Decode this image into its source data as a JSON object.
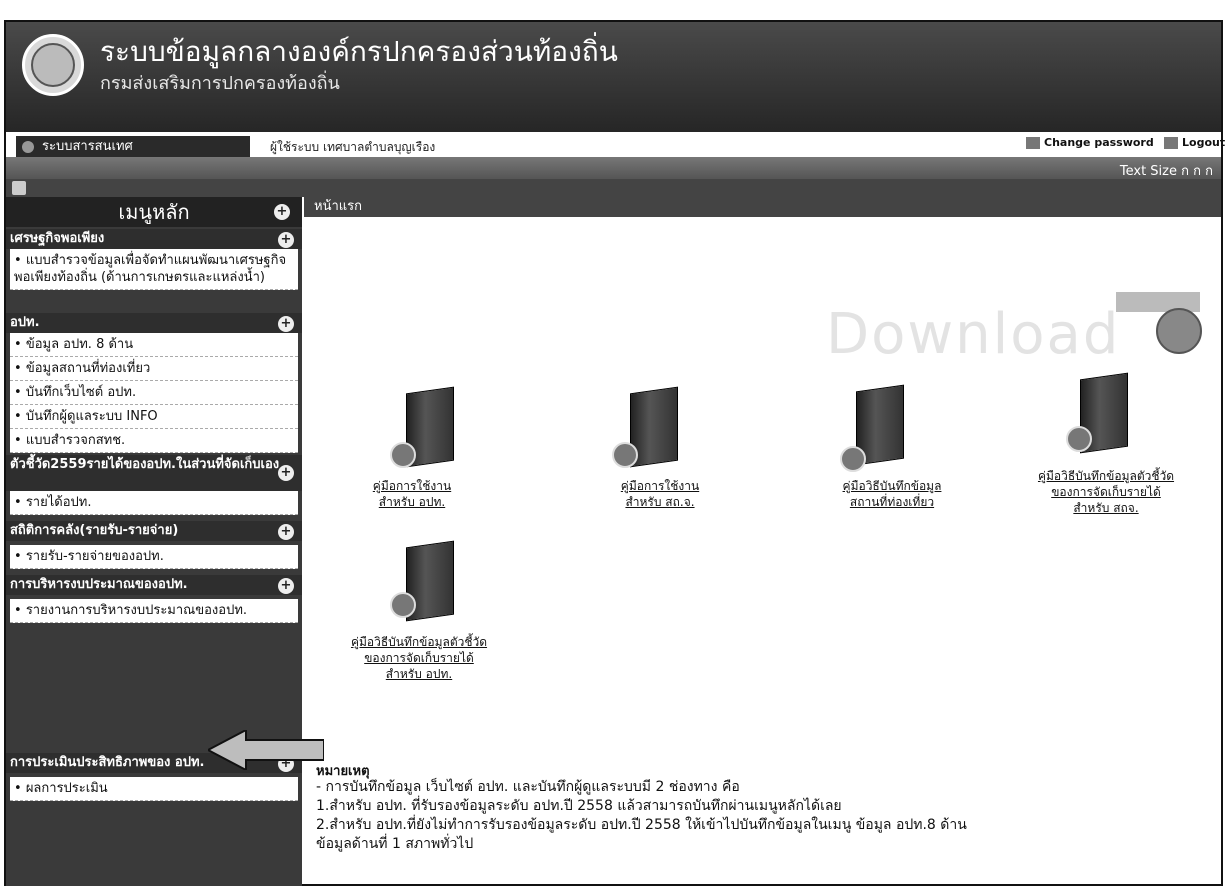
{
  "header": {
    "title": "ระบบข้อมูลกลางองค์กรปกครองส่วนท้องถิ่น",
    "subtitle": "กรมส่งเสริมการปกครองท้องถิ่น",
    "tab_label": "ระบบสารสนเทศ",
    "user_line": "ผู้ใช้ระบบ เทศบาลตำบลบุญเรือง",
    "change_password": "Change password",
    "logout": "Logout",
    "text_size": "Text Size ก ก ก"
  },
  "sidebar": {
    "menu_title": "เมนูหลัก",
    "sections": [
      {
        "title": "เศรษฐกิจพอเพียง",
        "items": [
          "แบบสำรวจข้อมูลเพื่อจัดทำแผนพัฒนาเศรษฐกิจพอเพียงท้องถิ่น (ด้านการเกษตรและแหล่งน้ำ)"
        ]
      },
      {
        "title": "อปท.",
        "items": [
          "ข้อมูล อปท. 8 ด้าน",
          "ข้อมูลสถานที่ท่องเที่ยว",
          "บันทึกเว็บไซต์ อปท.",
          "บันทึกผู้ดูแลระบบ INFO",
          "แบบสำรวจกสทช."
        ]
      },
      {
        "title": "ตัวชี้วัด2559รายได้ของอปท.ในส่วนที่จัดเก็บเอง",
        "items": [
          "รายได้อปท."
        ]
      },
      {
        "title": "สถิติการคลัง(รายรับ-รายจ่าย)",
        "items": [
          "รายรับ-รายจ่ายของอปท."
        ]
      },
      {
        "title": "การบริหารงบประมาณของอปท.",
        "items": [
          "รายงานการบริหารงบประมาณของอปท."
        ]
      },
      {
        "title": "การประเมินประสิทธิภาพของ อปท.",
        "items": [
          "ผลการประเมิน"
        ]
      }
    ]
  },
  "content": {
    "breadcrumb": "หน้าแรก",
    "download_text": "Download",
    "manuals": [
      {
        "line1": "คู่มือการใช้งาน",
        "line2": "สำหรับ อปท."
      },
      {
        "line1": "คู่มือการใช้งาน",
        "line2": "สำหรับ สถ.จ."
      },
      {
        "line1": "คู่มือวิธีบันทึกข้อมูล",
        "line2": "สถานที่ท่องเที่ยว"
      },
      {
        "line1": "คู่มือวิธีบันทึกข้อมูลตัวชี้วัด",
        "line2": "ของการจัดเก็บรายได้",
        "line3": "สำหรับ สถจ."
      },
      {
        "line1": "คู่มือวิธีบันทึกข้อมูลตัวชี้วัด",
        "line2": "ของการจัดเก็บรายได้",
        "line3": "สำหรับ อปท."
      }
    ],
    "notes_head": "หมายเหตุ",
    "notes": [
      "- การบันทึกข้อมูล เว็บไซต์ อปท. และบันทึกผู้ดูแลระบบมี 2 ช่องทาง คือ",
      "1.สำหรับ อปท. ที่รับรองข้อมูลระดับ อปท.ปี 2558 แล้วสามารถบันทึกผ่านเมนูหลักได้เลย",
      "2.สำหรับ อปท.ที่ยังไม่ทำการรับรองข้อมูลระดับ อปท.ปี 2558 ให้เข้าไปบันทึกข้อมูลในเมนู ข้อมูล อปท.8 ด้าน",
      "ข้อมูลด้านที่ 1 สภาพทั่วไป"
    ]
  }
}
